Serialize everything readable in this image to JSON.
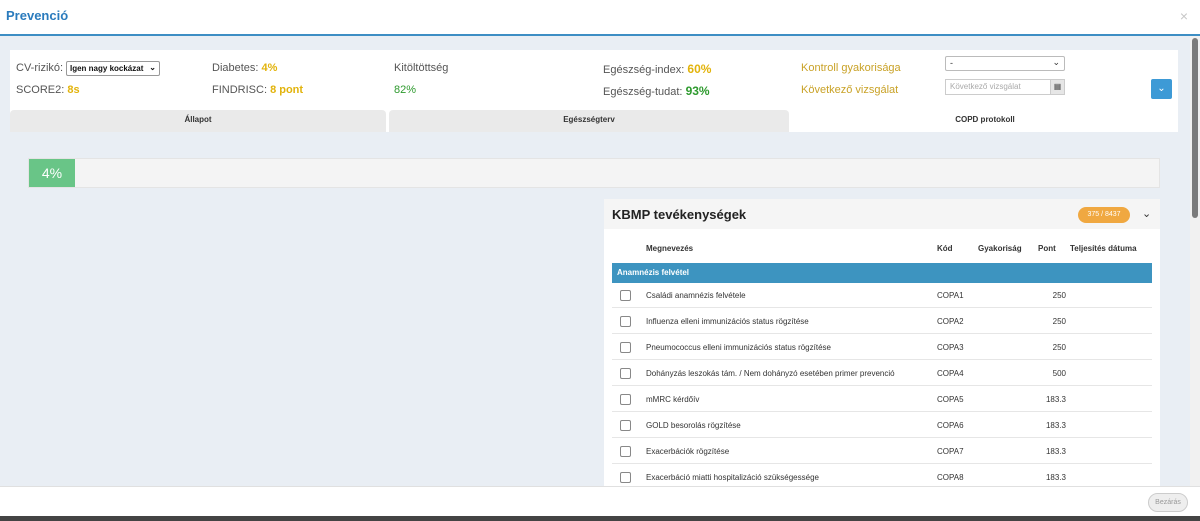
{
  "modal": {
    "title": "Prevenció",
    "close_glyph": "×"
  },
  "status": {
    "cv_label": "CV-rizikó:",
    "cv_select": "Igen nagy kockázat",
    "score2_label": "SCORE2:",
    "score2_value": "8s",
    "diabetes_label": "Diabetes:",
    "diabetes_value": "4%",
    "findrisc_label": "FINDRISC:",
    "findrisc_value": "8 pont",
    "kitoltottseg_label": "Kitöltöttség",
    "kitoltottseg_value": "82%",
    "index_label": "Egészség-index:",
    "index_value": "60%",
    "tudat_label": "Egészség-tudat:",
    "tudat_value": "93%",
    "kontroll_label": "Kontroll gyakorisága",
    "kontroll_value": "-",
    "kovetkezo_label": "Következő vizsgálat",
    "kovetkezo_placeholder": "Következő vizsgálat"
  },
  "tabs": [
    {
      "label": "Állapot",
      "active": false
    },
    {
      "label": "Egészségterv",
      "active": false
    },
    {
      "label": "COPD protokoll",
      "active": true
    }
  ],
  "progress": {
    "label": "4%",
    "fraction": 0.04
  },
  "kbmp": {
    "title": "KBMP tevékenységek",
    "badge": "375 / 8437",
    "columns": [
      "Megnevezés",
      "Kód",
      "Gyakoriság",
      "Pont",
      "Teljesítés dátuma"
    ],
    "section": "Anamnézis felvétel",
    "rows": [
      {
        "name": "Családi anamnézis felvétele",
        "code": "COPA1",
        "pont": "250"
      },
      {
        "name": "Influenza elleni immunizációs status rögzítése",
        "code": "COPA2",
        "pont": "250"
      },
      {
        "name": "Pneumococcus elleni immunizációs status rögzítése",
        "code": "COPA3",
        "pont": "250"
      },
      {
        "name": "Dohányzás leszokás tám. / Nem dohányzó esetében primer prevenció",
        "code": "COPA4",
        "pont": "500"
      },
      {
        "name": "mMRC kérdőív",
        "code": "COPA5",
        "pont": "183.3"
      },
      {
        "name": "GOLD besorolás rögzítése",
        "code": "COPA6",
        "pont": "183.3"
      },
      {
        "name": "Exacerbációk rögzítése",
        "code": "COPA7",
        "pont": "183.3"
      },
      {
        "name": "Exacerbáció miatti hospitalizáció szükségessége",
        "code": "COPA8",
        "pont": "183.3"
      }
    ]
  },
  "footer": {
    "close_label": "Bezárás"
  },
  "colors": {
    "accent": "#3d94c0",
    "progress": "#69c587",
    "badge": "#f0a841",
    "warning": "#e2b30b",
    "success": "#2e9a2e"
  }
}
